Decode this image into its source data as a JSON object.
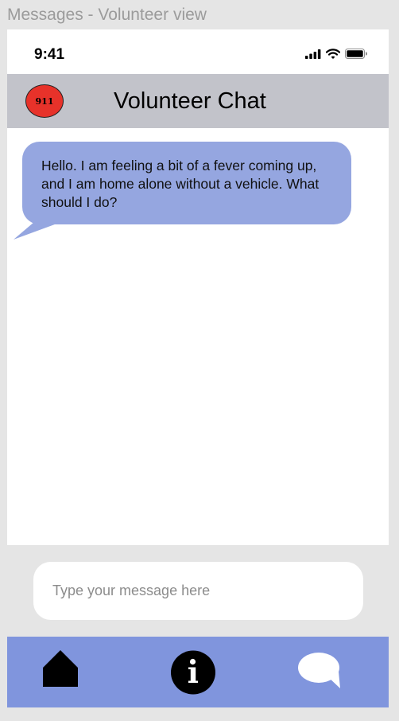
{
  "frame": {
    "title": "Messages - Volunteer view"
  },
  "status_bar": {
    "time": "9:41",
    "icons": [
      "signal-icon",
      "wifi-icon",
      "battery-icon"
    ]
  },
  "header": {
    "emergency_label": "911",
    "title": "Volunteer Chat"
  },
  "messages": [
    {
      "sender": "incoming",
      "text": "Hello. I am feeling a bit of a fever coming up, and I am home alone without a vehicle. What should I do?"
    }
  ],
  "composer": {
    "placeholder": "Type your message here",
    "value": ""
  },
  "tab_bar": {
    "items": [
      {
        "icon": "home-icon"
      },
      {
        "icon": "info-icon"
      },
      {
        "icon": "chat-bubble-icon"
      }
    ]
  },
  "colors": {
    "page_background": "#e5e5e5",
    "header_background": "#c2c3ca",
    "emergency_red": "#e7322a",
    "bubble_incoming": "#95a6e0",
    "tab_bar_background": "#8095dd"
  }
}
